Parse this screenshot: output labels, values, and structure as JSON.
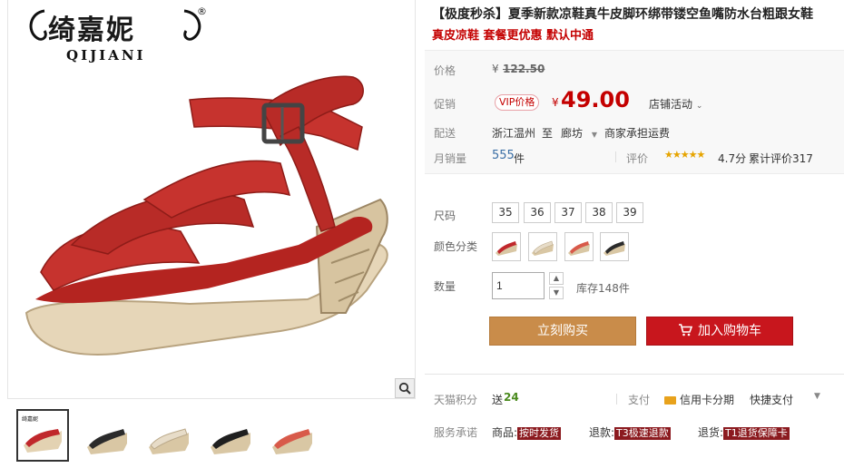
{
  "brand": {
    "name_cn": "绮嘉妮",
    "name_en": "QIJIANI",
    "reg": "®"
  },
  "gallery": {
    "zoom_icon": "search-icon",
    "thumbnails": [
      {
        "name": "thumb-red",
        "color": "#c0282c"
      },
      {
        "name": "thumb-black",
        "color": "#2b2b2b"
      },
      {
        "name": "thumb-beige",
        "color": "#e7dcc8"
      },
      {
        "name": "thumb-black-2",
        "color": "#1f1f1f"
      },
      {
        "name": "thumb-coral",
        "color": "#d85a4a"
      }
    ]
  },
  "product": {
    "title": "【极度秒杀】夏季新款凉鞋真牛皮脚环绑带镂空鱼嘴防水台粗跟女鞋",
    "subtitle": "真皮凉鞋 套餐更优惠 默认中通"
  },
  "price": {
    "label": "价格",
    "yen": "¥",
    "original": "122.50",
    "promo_label": "促销",
    "vip_badge": "VIP价格",
    "promo_price": "49.00",
    "store_activity": "店铺活动",
    "ship_label": "配送",
    "ship_from": "浙江温州",
    "ship_to_word": "至",
    "ship_to": "廊坊",
    "ship_fee": "商家承担运费",
    "sales_label": "月销量",
    "sales_count": "555",
    "sales_unit": "件",
    "rating_label": "评价",
    "rating_stars": 4.7,
    "rating_score": "4.7分",
    "review_count_text": "累计评价317"
  },
  "options": {
    "size_label": "尺码",
    "sizes": [
      "35",
      "36",
      "37",
      "38",
      "39"
    ],
    "color_label": "颜色分类",
    "colors": [
      "#c0282c",
      "#e7dcc8",
      "#d85a4a",
      "#2b2b2b"
    ],
    "qty_label": "数量",
    "qty_value": "1",
    "stock_text": "库存148件"
  },
  "actions": {
    "buy_now": "立刻购买",
    "add_cart": "加入购物车"
  },
  "service": {
    "points_label": "天猫积分",
    "points_text": "送",
    "points_value": "24",
    "pay_label": "支付",
    "credit_card": "信用卡分期",
    "quick_pay": "快捷支付",
    "promise_label": "服务承诺",
    "goods_label": "商品:",
    "goods_tag": "按时发货",
    "refund_label": "退款:",
    "refund_tag": "T3极速退款",
    "return_label": "退货:",
    "return_tag": "T1退货保障卡"
  },
  "colors": {
    "accent_red": "#c40000",
    "buy_orange": "#c98c4a",
    "cart_red": "#c8161d"
  }
}
